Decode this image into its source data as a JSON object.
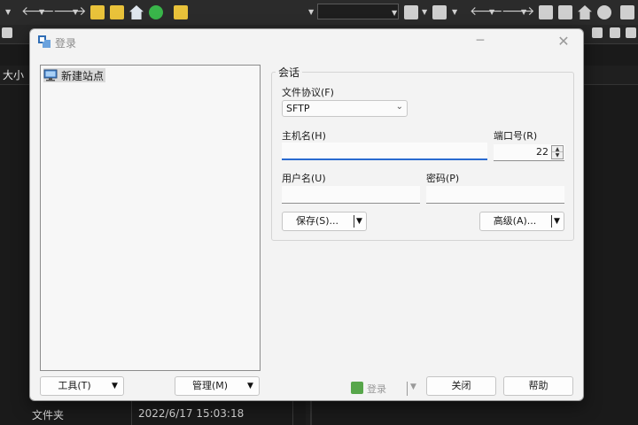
{
  "background": {
    "column_size_label": "大小",
    "row_type": "文件夹",
    "row_date": "2022/6/17  15:03:18"
  },
  "dialog": {
    "title": "登录",
    "minimize_glyph": "─",
    "close_glyph": "✕"
  },
  "site_tree": {
    "items": [
      {
        "label": "新建站点",
        "icon": "computer-icon"
      }
    ]
  },
  "session": {
    "legend": "会话",
    "protocol_label": "文件协议(F)",
    "protocol_value": "SFTP",
    "host_label": "主机名(H)",
    "host_value": "",
    "port_label": "端口号(R)",
    "port_value": "22",
    "user_label": "用户名(U)",
    "user_value": "",
    "password_label": "密码(P)",
    "password_value": "",
    "save_label": "保存(S)...",
    "advanced_label": "高级(A)..."
  },
  "footer": {
    "tools_label": "工具(T)",
    "manage_label": "管理(M)",
    "login_label": "登录",
    "close_label": "关闭",
    "help_label": "帮助"
  },
  "colors": {
    "accent_focus": "#2a6ad0",
    "dialog_bg": "#f3f3f3",
    "background_app": "#1e1e1e"
  }
}
